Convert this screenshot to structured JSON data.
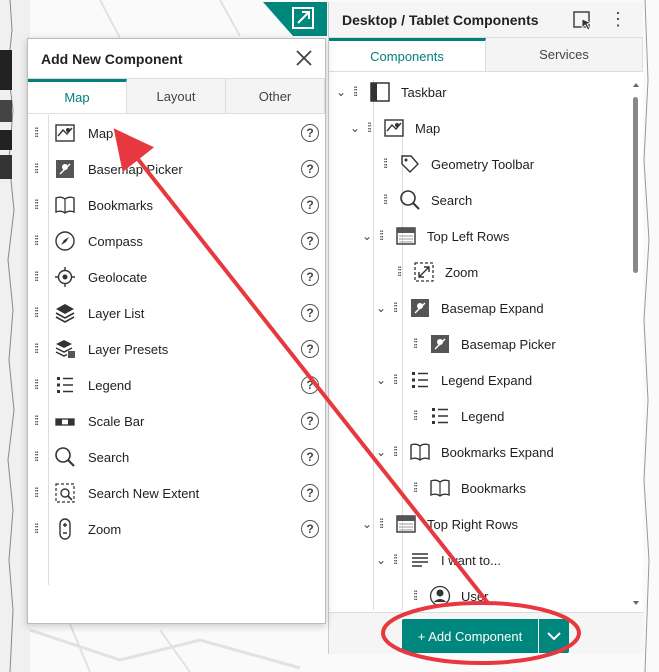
{
  "right_panel": {
    "title": "Desktop / Tablet Components",
    "tabs": [
      "Components",
      "Services"
    ],
    "tree": [
      {
        "label": "Taskbar",
        "icon": "taskbar-icon"
      },
      {
        "label": "Map",
        "icon": "map-icon"
      },
      {
        "label": "Geometry Toolbar",
        "icon": "geometry-toolbar-icon"
      },
      {
        "label": "Search",
        "icon": "search-icon"
      },
      {
        "label": "Top Left Rows",
        "icon": "rows-icon"
      },
      {
        "label": "Zoom",
        "icon": "zoom-extent-icon"
      },
      {
        "label": "Basemap Expand",
        "icon": "basemap-icon"
      },
      {
        "label": "Basemap Picker",
        "icon": "basemap-icon"
      },
      {
        "label": "Legend Expand",
        "icon": "legend-icon"
      },
      {
        "label": "Legend",
        "icon": "legend-icon"
      },
      {
        "label": "Bookmarks Expand",
        "icon": "bookmarks-icon"
      },
      {
        "label": "Bookmarks",
        "icon": "bookmarks-icon"
      },
      {
        "label": "Top Right Rows",
        "icon": "rows-icon"
      },
      {
        "label": "I want to...",
        "icon": "menu-icon"
      },
      {
        "label": "User",
        "icon": "user-icon"
      }
    ],
    "add_button": "+ Add Component"
  },
  "popup": {
    "title": "Add New Component",
    "tabs": [
      "Map",
      "Layout",
      "Other"
    ],
    "items": [
      {
        "label": "Map",
        "icon": "map-icon"
      },
      {
        "label": "Basemap Picker",
        "icon": "basemap-icon"
      },
      {
        "label": "Bookmarks",
        "icon": "bookmarks-icon"
      },
      {
        "label": "Compass",
        "icon": "compass-icon"
      },
      {
        "label": "Geolocate",
        "icon": "geolocate-icon"
      },
      {
        "label": "Layer List",
        "icon": "layer-list-icon"
      },
      {
        "label": "Layer Presets",
        "icon": "layer-presets-icon"
      },
      {
        "label": "Legend",
        "icon": "legend-icon"
      },
      {
        "label": "Scale Bar",
        "icon": "scale-bar-icon"
      },
      {
        "label": "Search",
        "icon": "search-icon"
      },
      {
        "label": "Search New Extent",
        "icon": "search-extent-icon"
      },
      {
        "label": "Zoom",
        "icon": "zoom-icon"
      }
    ],
    "help_glyph": "?"
  },
  "colors": {
    "accent": "#00877d",
    "annotation": "#e8383f"
  }
}
